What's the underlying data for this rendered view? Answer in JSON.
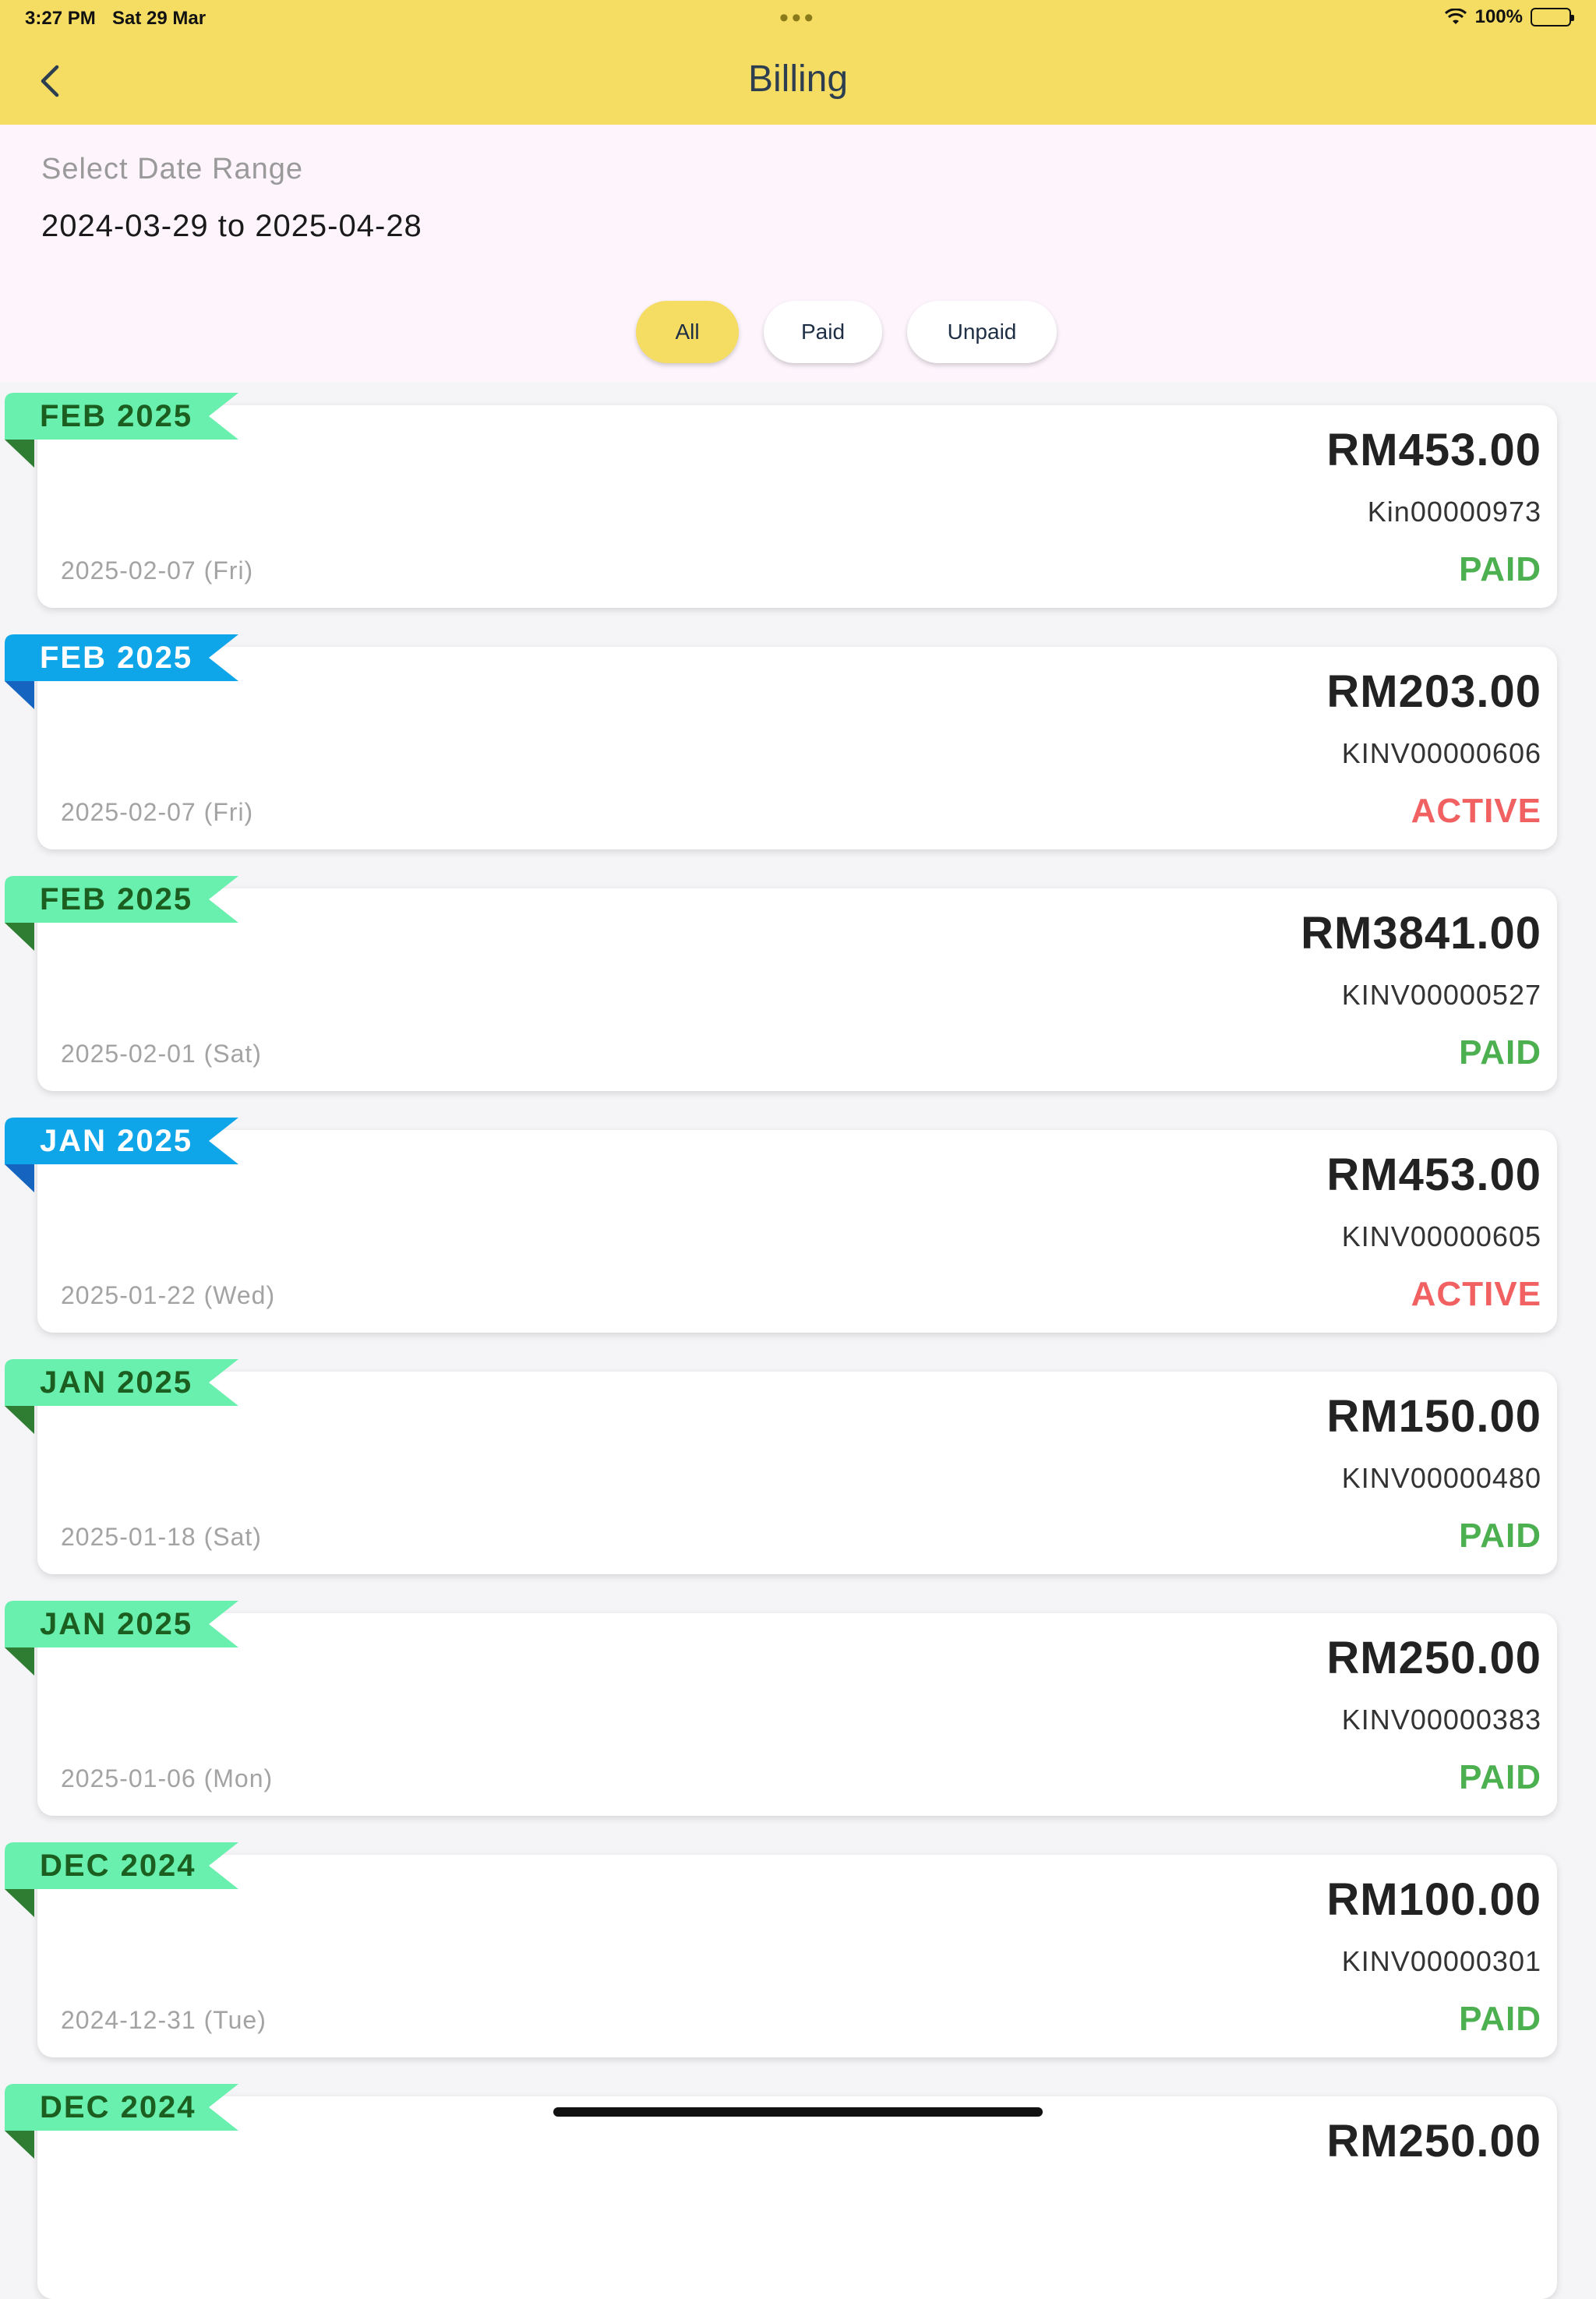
{
  "status_bar": {
    "time": "3:27 PM",
    "date": "Sat 29 Mar",
    "dots": "•••",
    "battery": "100%"
  },
  "header": {
    "title": "Billing"
  },
  "filter": {
    "range_label": "Select Date Range",
    "range_value": "2024-03-29 to 2025-04-28",
    "chips": [
      "All",
      "Paid",
      "Unpaid"
    ],
    "selected": "All"
  },
  "colors": {
    "app_bar": "#f5dd63",
    "paid": "#4caf50",
    "active": "#f26161",
    "ribbon_green": "#69f0ae",
    "ribbon_blue": "#0ea5e9"
  },
  "bills": [
    {
      "month": "FEB 2025",
      "amount": "RM453.00",
      "invoice": "Kin00000973",
      "status": "PAID",
      "date": "2025-02-07 (Fri)"
    },
    {
      "month": "FEB 2025",
      "amount": "RM203.00",
      "invoice": "KINV00000606",
      "status": "ACTIVE",
      "date": "2025-02-07 (Fri)"
    },
    {
      "month": "FEB 2025",
      "amount": "RM3841.00",
      "invoice": "KINV00000527",
      "status": "PAID",
      "date": "2025-02-01 (Sat)"
    },
    {
      "month": "JAN 2025",
      "amount": "RM453.00",
      "invoice": "KINV00000605",
      "status": "ACTIVE",
      "date": "2025-01-22 (Wed)"
    },
    {
      "month": "JAN 2025",
      "amount": "RM150.00",
      "invoice": "KINV00000480",
      "status": "PAID",
      "date": "2025-01-18 (Sat)"
    },
    {
      "month": "JAN 2025",
      "amount": "RM250.00",
      "invoice": "KINV00000383",
      "status": "PAID",
      "date": "2025-01-06 (Mon)"
    },
    {
      "month": "DEC 2024",
      "amount": "RM100.00",
      "invoice": "KINV00000301",
      "status": "PAID",
      "date": "2024-12-31 (Tue)"
    },
    {
      "month": "DEC 2024",
      "amount": "RM250.00",
      "invoice": "",
      "status": "",
      "date": ""
    }
  ]
}
